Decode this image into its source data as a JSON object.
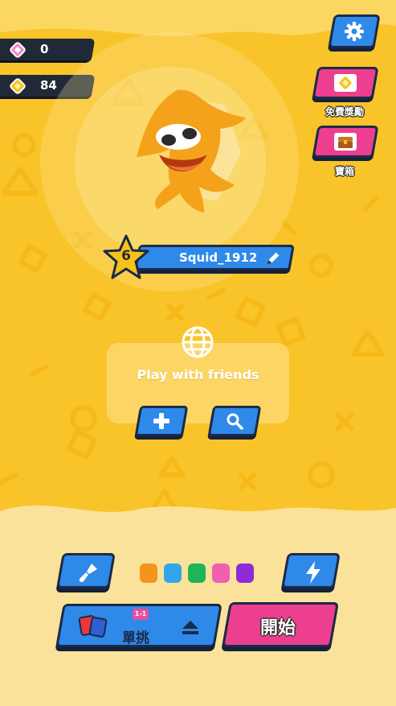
{
  "currencies": [
    {
      "name": "gems",
      "icon": "pink-diamond-icon",
      "value": "0"
    },
    {
      "name": "coins",
      "icon": "gold-coin-icon",
      "value": "84"
    }
  ],
  "side_buttons": {
    "free_rewards_label": "免費獎勵",
    "treasure_label": "寶箱"
  },
  "player": {
    "level": "6",
    "name": "Squid_1912"
  },
  "friends": {
    "title": "Play with friends"
  },
  "bottom": {
    "mode_label": "單挑",
    "mode_badge": "1-1",
    "start_label": "開始",
    "colors": [
      "#f4931e",
      "#2ea7ea",
      "#1fb45a",
      "#f15fb0",
      "#8d2bd6"
    ]
  },
  "theme": {
    "background": "#f9c42a",
    "accent_blue": "#2f89e8",
    "accent_pink": "#ec3f8f",
    "outline": "#1b2a47"
  }
}
